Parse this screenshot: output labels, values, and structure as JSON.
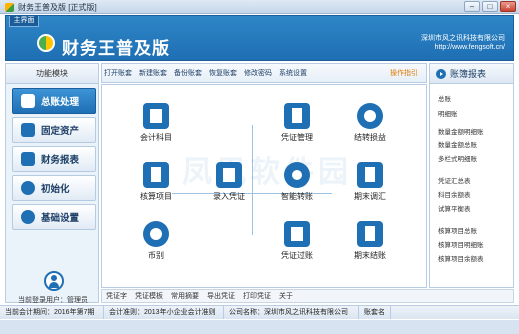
{
  "window": {
    "title": "财务王普及版 [正式版]",
    "minimize": "–",
    "maximize": "□",
    "close": "×"
  },
  "header": {
    "home_tab": "主界面",
    "app_title": "财务王普及版",
    "company": "深圳市风之讯科技有限公司",
    "website": "http://www.fengsoft.cn/"
  },
  "sidebar": {
    "title": "功能模块",
    "items": [
      {
        "label": "总账处理",
        "icon": "ledger-icon",
        "active": true
      },
      {
        "label": "固定资产",
        "icon": "asset-icon",
        "active": false
      },
      {
        "label": "财务报表",
        "icon": "report-icon",
        "active": false
      },
      {
        "label": "初始化",
        "icon": "init-icon",
        "active": false
      },
      {
        "label": "基础设置",
        "icon": "settings-icon",
        "active": false
      }
    ],
    "user_text": "当前登录用户：管理员"
  },
  "toolbar": {
    "links": [
      "打开账套",
      "新建账套",
      "备份账套",
      "恢复账套",
      "修改密码",
      "系统设置"
    ],
    "guide": "操作指引"
  },
  "main": {
    "watermark": "凤凰软件园",
    "functions": [
      {
        "label": "会计科目",
        "icon": "account-book-icon"
      },
      {
        "label": "凭证管理",
        "icon": "voucher-manage-icon"
      },
      {
        "label": "结转损益",
        "icon": "pie-chart-icon"
      },
      {
        "label": "核算项目",
        "icon": "accounting-item-icon"
      },
      {
        "label": "录入凭证",
        "icon": "enter-voucher-icon"
      },
      {
        "label": "智能转账",
        "icon": "smart-transfer-icon"
      },
      {
        "label": "期末调汇",
        "icon": "exchange-adjust-icon"
      },
      {
        "label": "币别",
        "icon": "currency-icon"
      },
      {
        "label": "凭证过账",
        "icon": "post-voucher-icon"
      },
      {
        "label": "期末结账",
        "icon": "period-close-icon"
      }
    ]
  },
  "right_panel": {
    "title": "账簿报表",
    "items": [
      "总账",
      "明细账",
      "数量金额明细账",
      "数量金额总账",
      "多栏式明细账",
      "凭证汇总表",
      "科目余额表",
      "试算平衡表",
      "核算项目总账",
      "核算项目明细账",
      "核算项目余额表"
    ]
  },
  "bottom_toolbar": {
    "links": [
      "凭证字",
      "凭证模板",
      "常用摘要",
      "导出凭证",
      "打印凭证",
      "关于"
    ]
  },
  "statusbar": {
    "period": "当前会计期间：2016年第7期",
    "standard": "会计准则：2013年小企业会计准则",
    "company": "公司名称：深圳市风之讯科技有限公司",
    "account": "账套名"
  },
  "colors": {
    "primary": "#1f6fb4",
    "header": "#2e86c7",
    "accent": "#e07b00"
  }
}
